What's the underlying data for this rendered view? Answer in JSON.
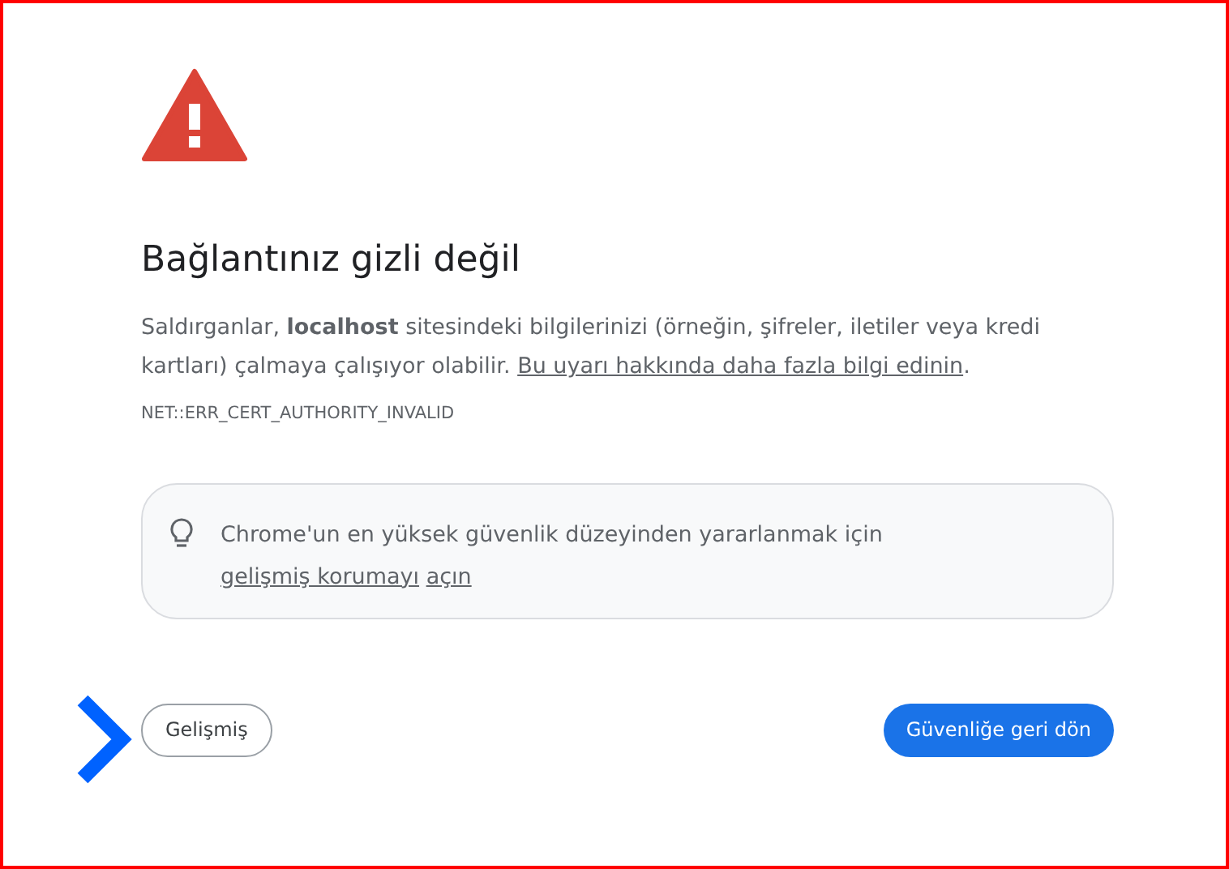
{
  "heading": "Bağlantınız gizli değil",
  "description": {
    "text": "Saldırganlar, **localhost** sitesindeki bilgilerinizi (örneğin, şifreler, iletiler veya kredi kartları) çalmaya çalışıyor olabilir.",
    "link": "Bu uyarı hakkında daha fazla bilgi edinin",
    "after": "."
  },
  "error_code": "NET::ERR_CERT_AUTHORITY_INVALID",
  "tip": {
    "text": "Chrome'un en yüksek güvenlik düzeyinden yararlanmak için",
    "link_parts": [
      "gelişmiş korumayı",
      "açın"
    ]
  },
  "buttons": [
    {
      "kind": "secondary",
      "label": "Gelişmiş"
    },
    {
      "kind": "primary",
      "label": "Güvenliğe geri dön"
    }
  ]
}
